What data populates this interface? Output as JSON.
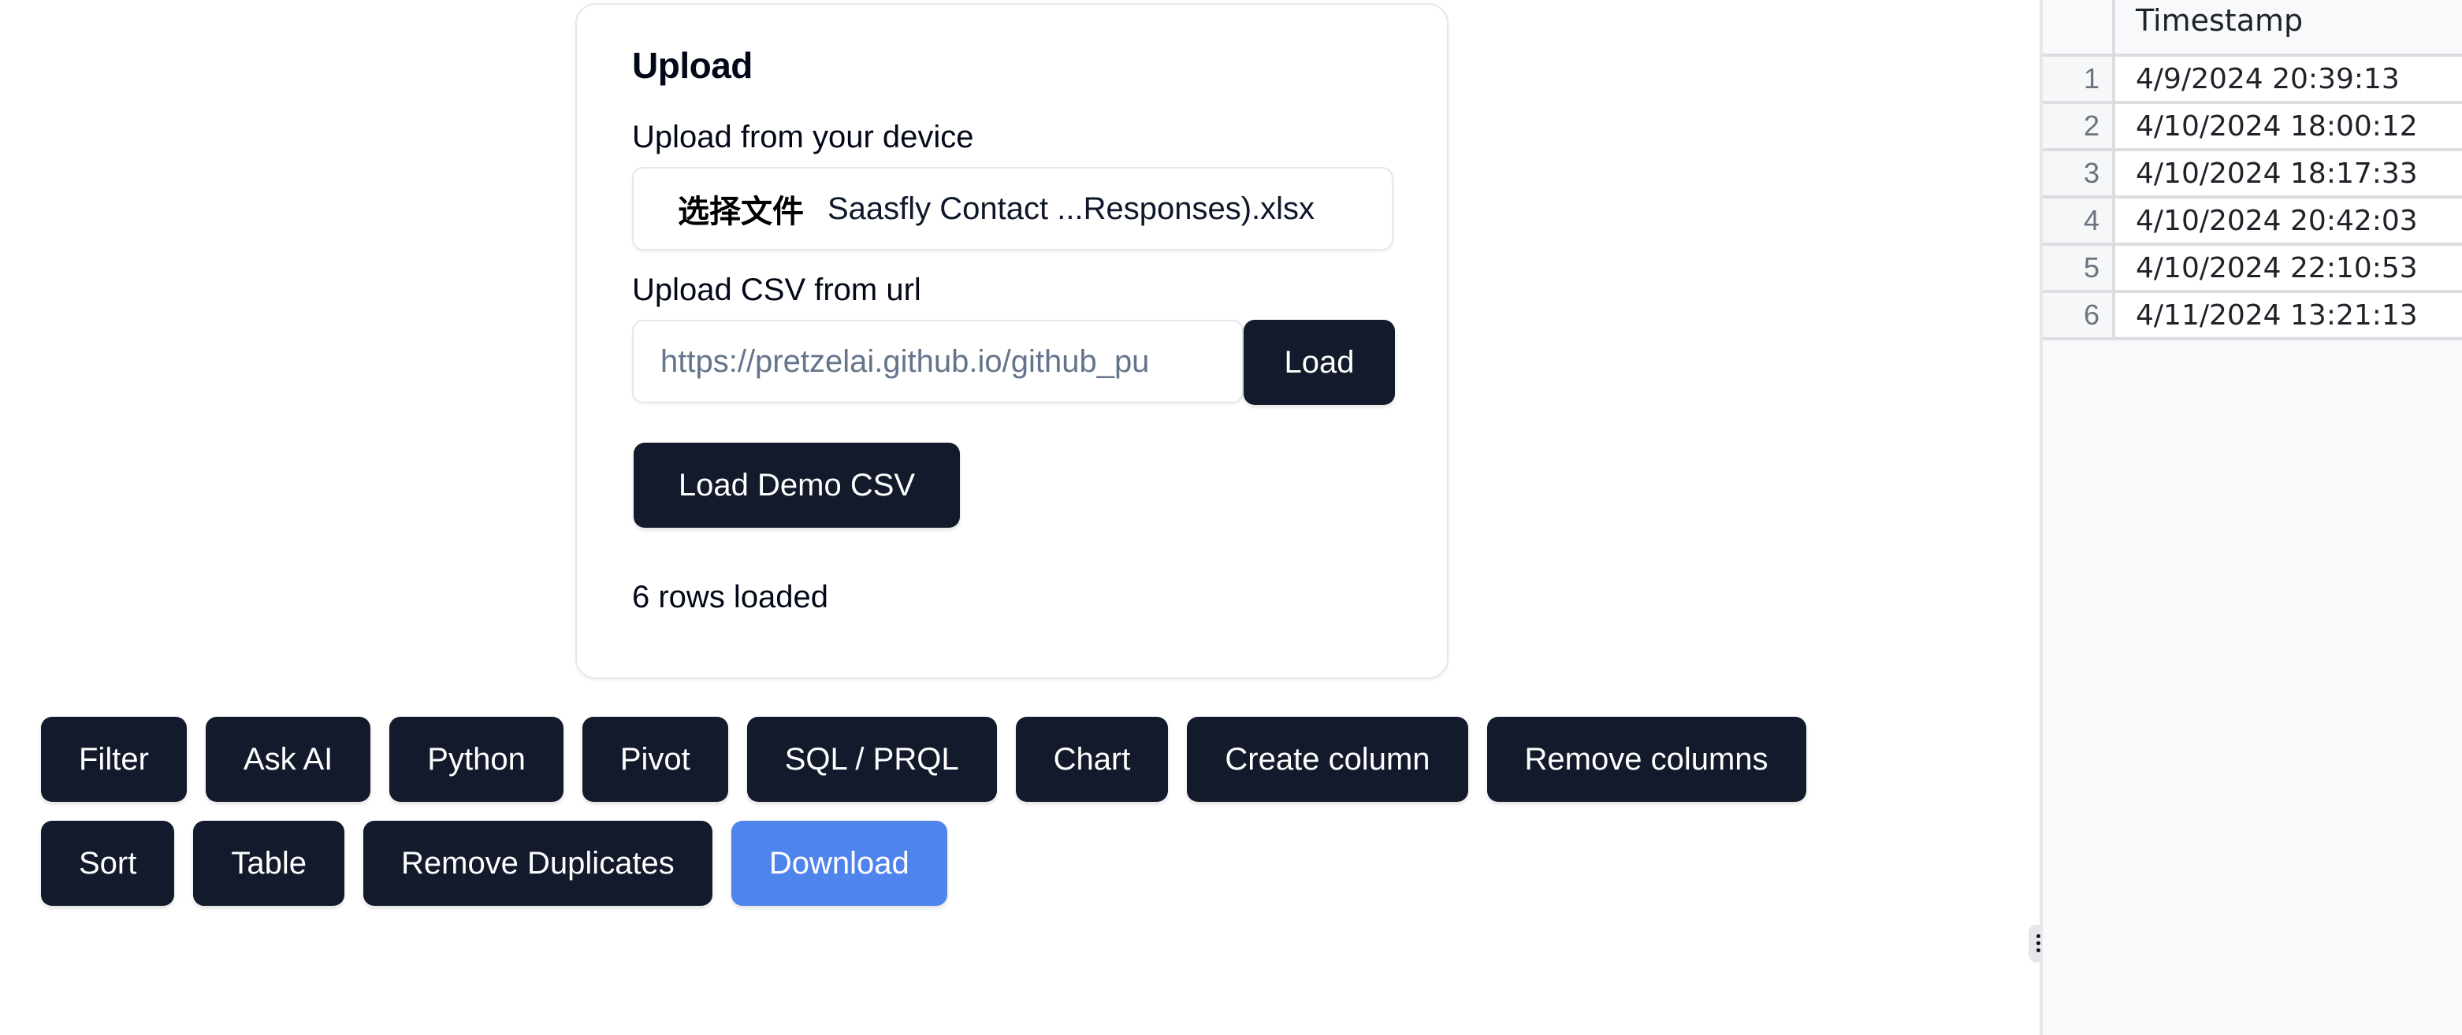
{
  "upload": {
    "title": "Upload",
    "device_label": "Upload from your device",
    "file_button_label": "选择文件",
    "file_name": "Saasfly Contact ...Responses).xlsx",
    "url_label": "Upload CSV from url",
    "url_placeholder": "https://pretzelai.github.io/github_pu",
    "load_button": "Load",
    "demo_button": "Load Demo CSV",
    "status": "6 rows loaded"
  },
  "toolbar": {
    "row1": [
      "Filter",
      "Ask AI",
      "Python",
      "Pivot",
      "SQL / PRQL",
      "Chart",
      "Create column",
      "Remove columns"
    ],
    "row2": [
      "Sort",
      "Table",
      "Remove Duplicates",
      "Download"
    ],
    "primary_color": "#4f84ec",
    "dark_color": "#131a2b"
  },
  "grid": {
    "columns": [
      "Timestamp"
    ],
    "rows": [
      {
        "num": "1",
        "Timestamp": "4/9/2024 20:39:13"
      },
      {
        "num": "2",
        "Timestamp": "4/10/2024 18:00:12"
      },
      {
        "num": "3",
        "Timestamp": "4/10/2024 18:17:33"
      },
      {
        "num": "4",
        "Timestamp": "4/10/2024 20:42:03"
      },
      {
        "num": "5",
        "Timestamp": "4/10/2024 22:10:53"
      },
      {
        "num": "6",
        "Timestamp": "4/11/2024 13:21:13"
      }
    ]
  },
  "icons": {
    "resize_handle": "drag-handle-icon"
  }
}
